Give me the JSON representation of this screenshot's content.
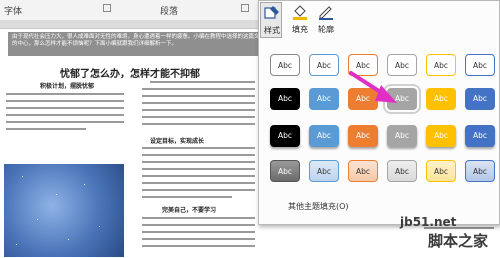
{
  "ribbon": {
    "group_left": "字体",
    "group_paragraph": "段落",
    "group_styles": "样式"
  },
  "document": {
    "banner_text": "由于现代社会压力大，很人成难面对无性的难境，身心遭遇着一样的疲惫。小编在教程中选择的这篇文章的中心，那么怎样才能不烦恼呢？下面小编就跟我们详细解析一下。",
    "title": "忧郁了怎么办，怎样才能不抑郁",
    "subheading_1": "积极计划，摆脱忧郁",
    "subheading_2": "设定目标，实现成长",
    "subheading_3": "完美自己，不要学习"
  },
  "gallery": {
    "tools": [
      {
        "label": "样式",
        "icon": "shape-style-icon"
      },
      {
        "label": "填充",
        "icon": "paint-bucket-icon"
      },
      {
        "label": "轮廓",
        "icon": "pen-outline-icon"
      }
    ],
    "swatch_label": "Abc",
    "swatch_rows": [
      [
        "white-gray",
        "white-blue",
        "white-orange",
        "white-gray",
        "white-gold",
        "white-blue"
      ],
      [
        "black",
        "blue",
        "orange",
        "gray",
        "gold",
        "blue"
      ],
      [
        "black",
        "blue",
        "orange",
        "gray",
        "gold",
        "blue"
      ],
      [
        "gray",
        "light-blue",
        "light-orange",
        "light-gray",
        "light-gold",
        "light-blue"
      ]
    ],
    "more_fills": "其他主题填充(O)"
  },
  "watermark": {
    "site": "jb51.net",
    "name": "脚本之家"
  },
  "colors": {
    "arrow": "#e12ec5"
  }
}
